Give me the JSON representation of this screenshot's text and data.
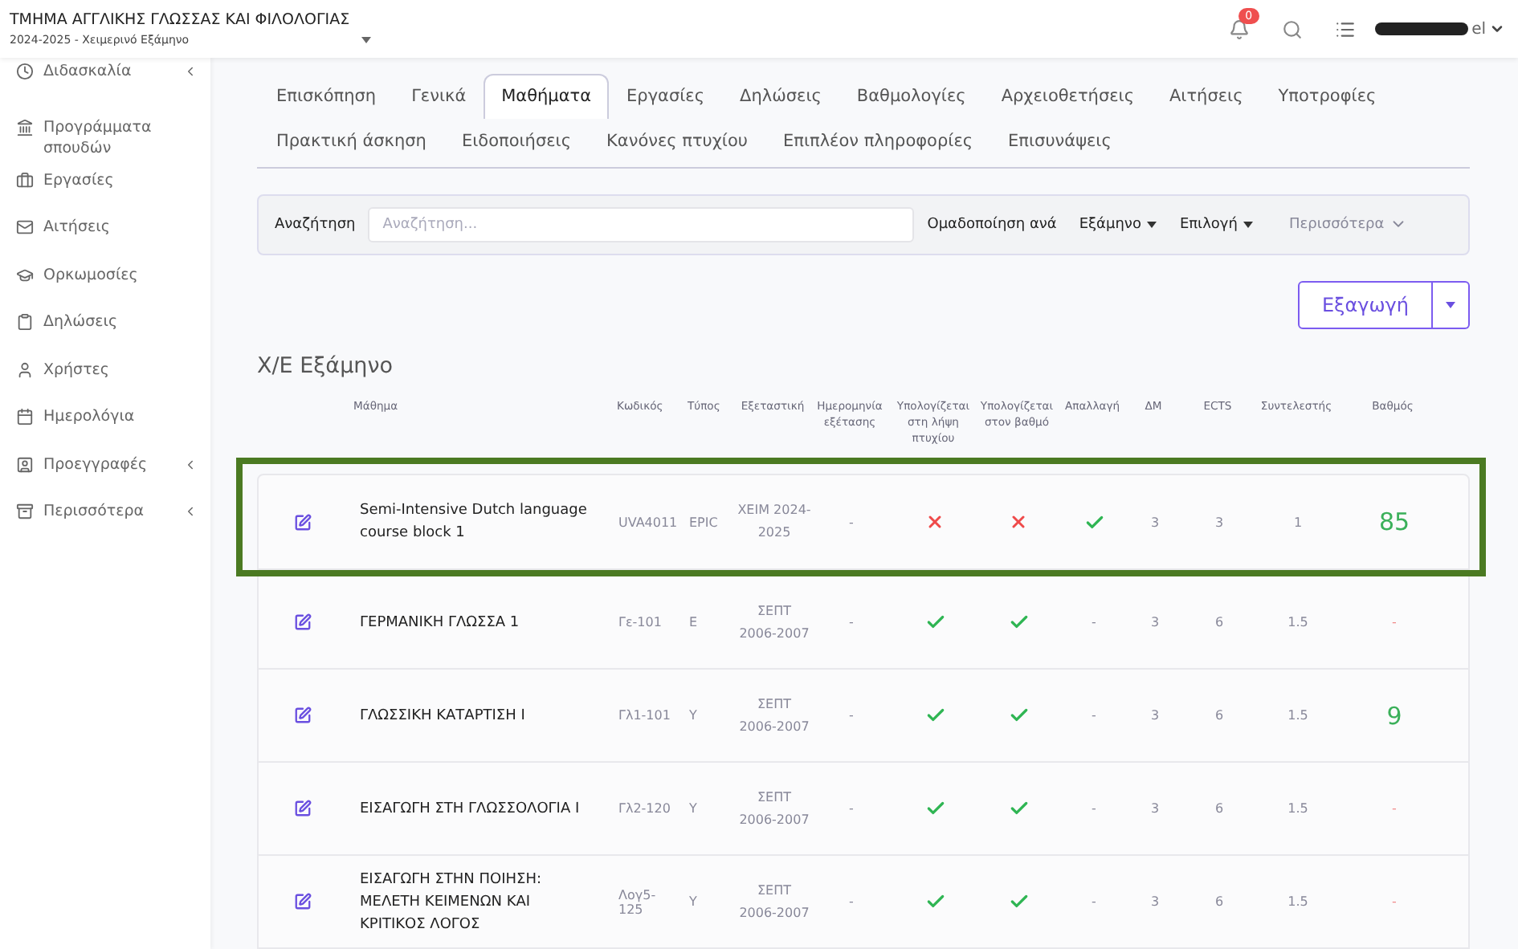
{
  "header": {
    "department": "ΤΜΗΜΑ ΑΓΓΛΙΚΗΣ ΓΛΩΣΣΑΣ ΚΑΙ ΦΙΛΟΛΟΓΙΑΣ",
    "period": "2024-2025 - Χειμερινό Εξάμηνο",
    "notifications": "0",
    "user_suffix": "el"
  },
  "sidebar": {
    "items": [
      {
        "label": "Διδασκαλία",
        "submenu": true
      },
      {
        "label": "Προγράμματα σπουδών",
        "submenu": false
      },
      {
        "label": "Εργασίες",
        "submenu": false
      },
      {
        "label": "Αιτήσεις",
        "submenu": false
      },
      {
        "label": "Ορκωμοσίες",
        "submenu": false
      },
      {
        "label": "Δηλώσεις",
        "submenu": false
      },
      {
        "label": "Χρήστες",
        "submenu": false
      },
      {
        "label": "Ημερολόγια",
        "submenu": false
      },
      {
        "label": "Προεγγραφές",
        "submenu": true
      },
      {
        "label": "Περισσότερα",
        "submenu": true
      }
    ]
  },
  "tabs": [
    {
      "label": "Επισκόπηση",
      "selected": false
    },
    {
      "label": "Γενικά",
      "selected": false
    },
    {
      "label": "Μαθήματα",
      "selected": true
    },
    {
      "label": "Εργασίες",
      "selected": false
    },
    {
      "label": "Δηλώσεις",
      "selected": false
    },
    {
      "label": "Βαθμολογίες",
      "selected": false
    },
    {
      "label": "Αρχειοθετήσεις",
      "selected": false
    },
    {
      "label": "Αιτήσεις",
      "selected": false
    },
    {
      "label": "Υποτροφίες",
      "selected": false
    },
    {
      "label": "Πρακτική άσκηση",
      "selected": false
    },
    {
      "label": "Ειδοποιήσεις",
      "selected": false
    },
    {
      "label": "Κανόνες πτυχίου",
      "selected": false
    },
    {
      "label": "Επιπλέον πληροφορίες",
      "selected": false
    },
    {
      "label": "Επισυνάψεις",
      "selected": false
    }
  ],
  "filter_bar": {
    "search_label": "Αναζήτηση",
    "search_placeholder": "Αναζήτηση...",
    "group_label": "Ομαδοποίηση ανά",
    "dropdowns": [
      "Εξάμηνο",
      "Επιλογή"
    ],
    "more": "Περισσότερα"
  },
  "export_button": "Εξαγωγή",
  "section_title": "Χ/Ε Εξάμηνο",
  "table": {
    "columns": [
      "Μάθημα",
      "Κωδικός",
      "Τύπος",
      "Εξεταστική",
      "Ημερομηνία εξέτασης",
      "Υπολογίζεται στη λήψη πτυχίου",
      "Υπολογίζεται στον βαθμό",
      "Απαλλαγή",
      "ΔΜ",
      "ECTS",
      "Συντελεστής",
      "Βαθμός"
    ],
    "rows": [
      {
        "highlighted": true,
        "course": "Semi-Intensive Dutch language course block 1",
        "code": "UVA4011",
        "type": "EPIC",
        "exam_period": "ΧΕΙΜ 2024-2025",
        "exam_date": "-",
        "counts_for_degree": false,
        "counts_for_grade": false,
        "exemption": {
          "kind": "check",
          "checked": true
        },
        "dm": "3",
        "ects": "3",
        "coefficient": "1",
        "grade": "85",
        "passed": true
      },
      {
        "highlighted": false,
        "course": "ΓΕΡΜΑΝΙΚΗ ΓΛΩΣΣΑ 1",
        "code": "Γε-101",
        "type": "Ε",
        "exam_period": "ΣΕΠΤ 2006-2007",
        "exam_date": "-",
        "counts_for_degree": true,
        "counts_for_grade": true,
        "exemption": {
          "kind": "text",
          "text": "-"
        },
        "dm": "3",
        "ects": "6",
        "coefficient": "1.5",
        "grade": "-",
        "passed": false
      },
      {
        "highlighted": false,
        "course": "ΓΛΩΣΣΙΚΗ ΚΑΤΑΡΤΙΣΗ Ι",
        "code": "Γλ1-101",
        "type": "Υ",
        "exam_period": "ΣΕΠΤ 2006-2007",
        "exam_date": "-",
        "counts_for_degree": true,
        "counts_for_grade": true,
        "exemption": {
          "kind": "text",
          "text": "-"
        },
        "dm": "3",
        "ects": "6",
        "coefficient": "1.5",
        "grade": "9",
        "passed": true
      },
      {
        "highlighted": false,
        "course": "ΕΙΣΑΓΩΓΗ ΣΤΗ ΓΛΩΣΣΟΛΟΓΙΑ Ι",
        "code": "Γλ2-120",
        "type": "Υ",
        "exam_period": "ΣΕΠΤ 2006-2007",
        "exam_date": "-",
        "counts_for_degree": true,
        "counts_for_grade": true,
        "exemption": {
          "kind": "text",
          "text": "-"
        },
        "dm": "3",
        "ects": "6",
        "coefficient": "1.5",
        "grade": "-",
        "passed": false
      },
      {
        "highlighted": false,
        "course": "ΕΙΣΑΓΩΓΗ ΣΤΗΝ ΠΟΙΗΣΗ: ΜΕΛΕΤΗ ΚΕΙΜΕΝΩΝ ΚΑΙ ΚΡΙΤΙΚΟΣ ΛΟΓΟΣ",
        "code": "Λογ5-125",
        "type": "Υ",
        "exam_period": "ΣΕΠΤ 2006-2007",
        "exam_date": "-",
        "counts_for_degree": true,
        "counts_for_grade": true,
        "exemption": {
          "kind": "text",
          "text": "-"
        },
        "dm": "3",
        "ects": "6",
        "coefficient": "1.5",
        "grade": "-",
        "passed": false
      }
    ]
  }
}
